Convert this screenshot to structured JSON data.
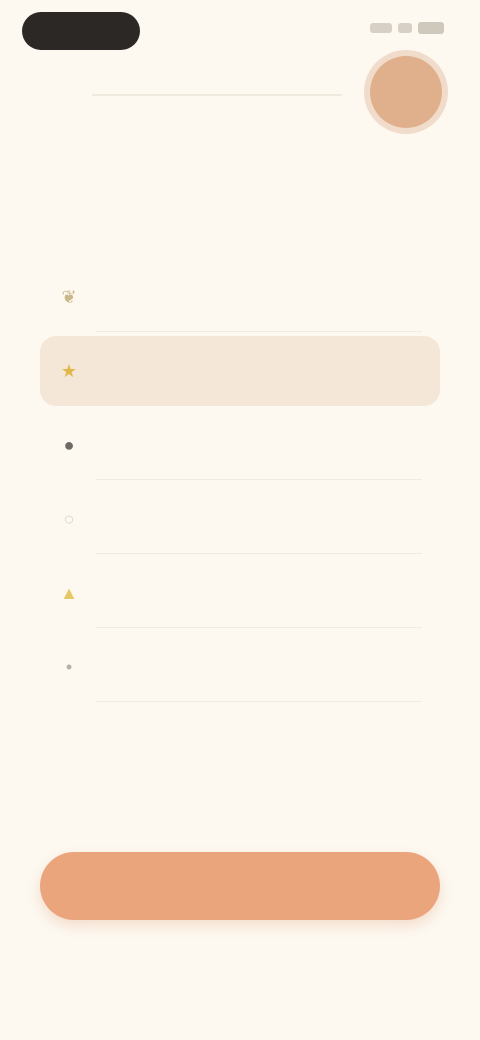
{
  "header": {
    "title": ""
  },
  "options": [
    {
      "label": "",
      "icon": "leaf-icon",
      "glyph": "❦",
      "color": "#c9b98a",
      "selected": false
    },
    {
      "label": "",
      "icon": "star-icon",
      "glyph": "★",
      "color": "#e0b84a",
      "selected": true
    },
    {
      "label": "",
      "icon": "circle-icon",
      "glyph": "●",
      "color": "#6f6a66",
      "selected": false
    },
    {
      "label": "",
      "icon": "ring-icon",
      "glyph": "○",
      "color": "#d8d2c8",
      "selected": false
    },
    {
      "label": "",
      "icon": "triangle-icon",
      "glyph": "▲",
      "color": "#e6c766",
      "selected": false
    },
    {
      "label": "",
      "icon": "dot-icon",
      "glyph": "•",
      "color": "#b7b0a6",
      "selected": false
    }
  ],
  "cta": {
    "label": ""
  },
  "colors": {
    "background": "#fdf9f1",
    "accent": "#eaa57d",
    "selected_row": "#f5e7d8"
  }
}
